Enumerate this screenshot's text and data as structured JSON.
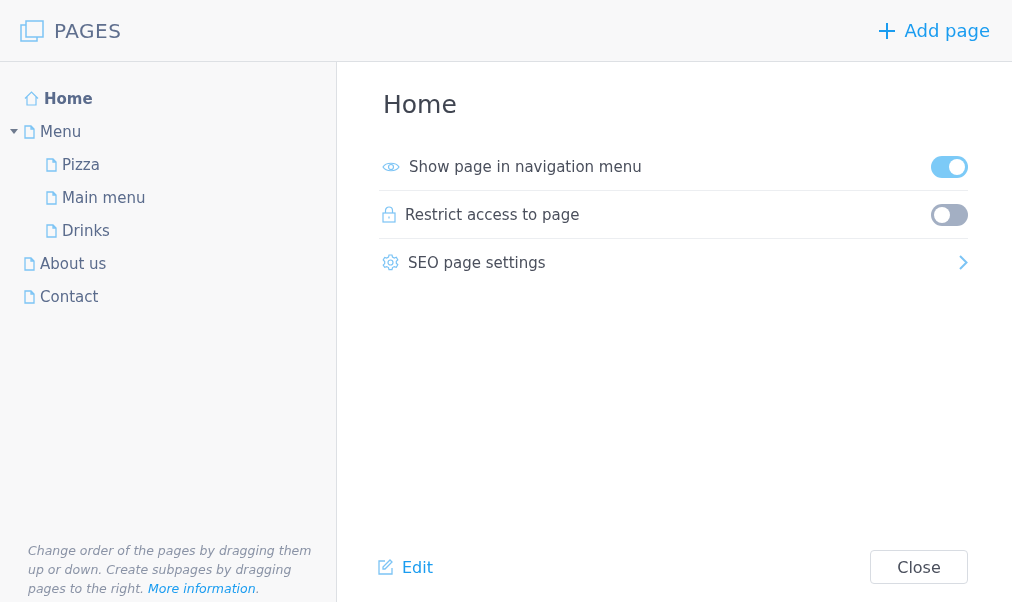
{
  "header": {
    "title": "PAGES",
    "add_button": "Add page"
  },
  "sidebar": {
    "items": [
      {
        "label": "Home",
        "kind": "home",
        "selected": true,
        "expanded": false
      },
      {
        "label": "Menu",
        "kind": "page",
        "selected": false,
        "expanded": true,
        "children": [
          {
            "label": "Pizza",
            "kind": "page",
            "selected": false
          },
          {
            "label": "Main menu",
            "kind": "page",
            "selected": false
          },
          {
            "label": "Drinks",
            "kind": "page",
            "selected": false
          }
        ]
      },
      {
        "label": "About us",
        "kind": "page",
        "selected": false,
        "expanded": false
      },
      {
        "label": "Contact",
        "kind": "page",
        "selected": false,
        "expanded": false
      }
    ],
    "help_text": "Change order of the pages by dragging them up or down. Create subpages by dragging pages to the right.",
    "help_link": "More information",
    "help_end": "."
  },
  "detail": {
    "title": "Home",
    "settings": [
      {
        "label": "Show page in navigation menu",
        "kind": "toggle",
        "on": true
      },
      {
        "label": "Restrict access to page",
        "kind": "toggle",
        "on": false
      },
      {
        "label": "SEO page settings",
        "kind": "link"
      }
    ],
    "edit_button": "Edit",
    "close_button": "Close"
  }
}
